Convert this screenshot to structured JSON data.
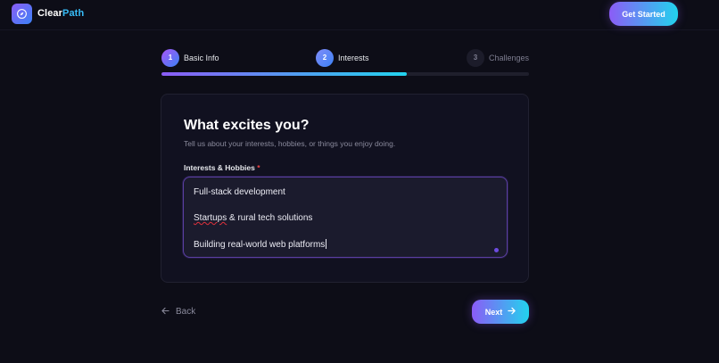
{
  "header": {
    "brand_part1": "Clear",
    "brand_part2": "Path",
    "logo_icon": "compass-icon",
    "cta_label": "Get Started"
  },
  "stepper": {
    "steps": [
      {
        "number": "1",
        "label": "Basic Info",
        "state": "complete"
      },
      {
        "number": "2",
        "label": "Interests",
        "state": "current"
      },
      {
        "number": "3",
        "label": "Challenges",
        "state": "upcoming"
      }
    ],
    "progress_fraction": 0.667
  },
  "form": {
    "title": "What excites you?",
    "subtitle": "Tell us about your interests, hobbies, or things you enjoy doing.",
    "field_label": "Interests & Hobbies",
    "required_marker": "*",
    "textarea_lines": [
      "Full-stack development",
      "Startups & rural tech solutions",
      "Building real-world web platforms"
    ],
    "misspelled_word": "Startups"
  },
  "nav": {
    "back_label": "Back",
    "back_icon": "arrow-left-icon",
    "next_label": "Next",
    "next_icon": "arrow-right-icon"
  },
  "colors": {
    "background": "#0d0d17",
    "accent_purple": "#8b5cf6",
    "accent_cyan": "#22d3ee",
    "required": "#ef4444"
  }
}
